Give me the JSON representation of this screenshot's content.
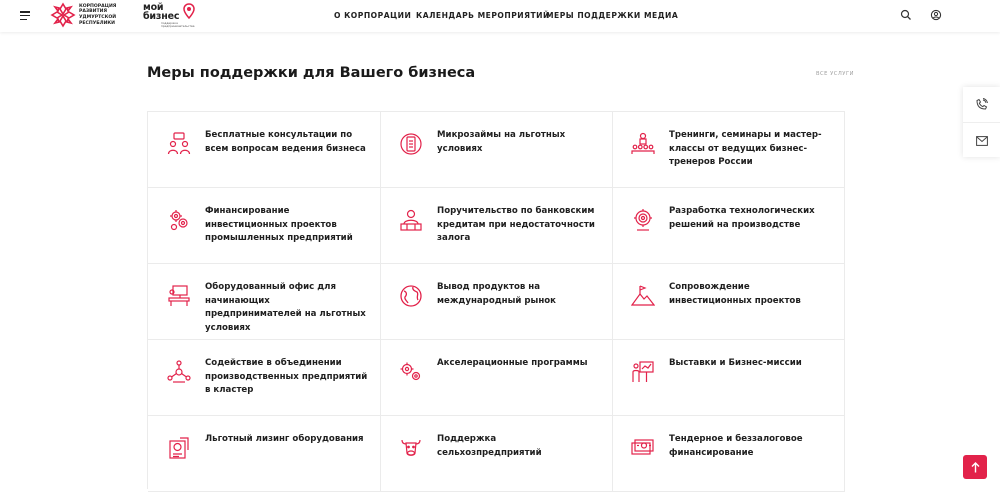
{
  "header": {
    "logo_corp_text": "КОРПОРАЦИЯ РАЗВИТИЯ УДМУРТСКОЙ РЕСПУБЛИКИ",
    "logo_mb_big": "мой бизнес",
    "logo_mb_small": "поддержка предпринимательства",
    "nav": [
      {
        "label": "О КОРПОРАЦИИ"
      },
      {
        "label": "КАЛЕНДАРЬ МЕРОПРИЯТИЙ"
      },
      {
        "label": "МЕРЫ ПОДДЕРЖКИ"
      },
      {
        "label": "МЕДИА"
      }
    ]
  },
  "main": {
    "title": "Меры поддержки для Вашего бизнеса",
    "all_services": "ВСЕ УСЛУГИ",
    "services": [
      {
        "label": "Бесплатные консультации по всем вопросам ведения бизнеса",
        "icon": "consultation-icon"
      },
      {
        "label": "Микрозаймы на льготных условиях",
        "icon": "microloan-icon"
      },
      {
        "label": "Тренинги, семинары и мастер-классы от ведущих бизнес-тренеров России",
        "icon": "training-icon"
      },
      {
        "label": "Финансирование инвестиционных проектов промышленных предприятий",
        "icon": "financing-gears-icon"
      },
      {
        "label": "Поручительство по банковским кредитам при недостаточности залога",
        "icon": "guarantee-icon"
      },
      {
        "label": "Разработка технологических решений на производстве",
        "icon": "tech-solutions-icon"
      },
      {
        "label": "Оборудованный офис для начинающих предпринимателей на льготных условиях",
        "icon": "office-icon"
      },
      {
        "label": "Вывод продуктов на международный рынок",
        "icon": "globe-icon"
      },
      {
        "label": "Сопровождение инвестиционных проектов",
        "icon": "mountain-flag-icon"
      },
      {
        "label": "Содействие в объединении производственных предприятий в кластер",
        "icon": "cluster-icon"
      },
      {
        "label": "Акселерационные программы",
        "icon": "acceleration-gears-icon"
      },
      {
        "label": "Выставки и Бизнес-миссии",
        "icon": "exhibition-icon"
      },
      {
        "label": "Льготный лизинг оборудования",
        "icon": "leasing-icon"
      },
      {
        "label": "Поддержка сельхозпредприятий",
        "icon": "cow-icon"
      },
      {
        "label": "Тендерное и беззалоговое финансирование",
        "icon": "money-icon"
      }
    ]
  },
  "colors": {
    "accent": "#e2224a",
    "text": "#1f1f1f",
    "border": "#ebebeb"
  }
}
